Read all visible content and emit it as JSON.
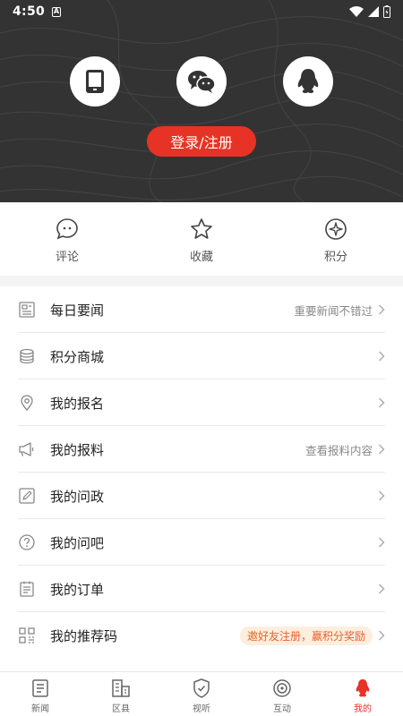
{
  "status_bar": {
    "time": "4:50",
    "notif": "A"
  },
  "header": {
    "login_methods": [
      {
        "id": "phone",
        "icon": "phone-icon"
      },
      {
        "id": "wechat",
        "icon": "wechat-icon"
      },
      {
        "id": "qq",
        "icon": "qq-icon"
      }
    ],
    "login_button": "登录/注册"
  },
  "quick_actions": [
    {
      "label": "评论",
      "icon": "comment-icon"
    },
    {
      "label": "收藏",
      "icon": "star-icon"
    },
    {
      "label": "积分",
      "icon": "points-icon"
    }
  ],
  "menu": [
    {
      "label": "每日要闻",
      "hint": "重要新闻不错过",
      "icon": "newspaper-icon"
    },
    {
      "label": "积分商城",
      "hint": "",
      "icon": "coins-icon"
    },
    {
      "label": "我的报名",
      "hint": "",
      "icon": "location-icon"
    },
    {
      "label": "我的报料",
      "hint": "查看报料内容",
      "icon": "megaphone-icon"
    },
    {
      "label": "我的问政",
      "hint": "",
      "icon": "edit-icon"
    },
    {
      "label": "我的问吧",
      "hint": "",
      "icon": "question-icon"
    },
    {
      "label": "我的订单",
      "hint": "",
      "icon": "order-icon"
    },
    {
      "label": "我的推荐码",
      "badge": "邀好友注册，赢积分奖励",
      "icon": "qrcode-icon"
    }
  ],
  "tabs": [
    {
      "label": "新闻",
      "icon": "news-tab-icon"
    },
    {
      "label": "区县",
      "icon": "district-tab-icon"
    },
    {
      "label": "视听",
      "icon": "video-tab-icon"
    },
    {
      "label": "互动",
      "icon": "interact-tab-icon"
    },
    {
      "label": "我的",
      "icon": "profile-tab-icon",
      "active": true
    }
  ],
  "colors": {
    "accent": "#e63325",
    "header_bg": "#333333",
    "badge_text": "#e8622c",
    "badge_bg": "#fdeede"
  }
}
